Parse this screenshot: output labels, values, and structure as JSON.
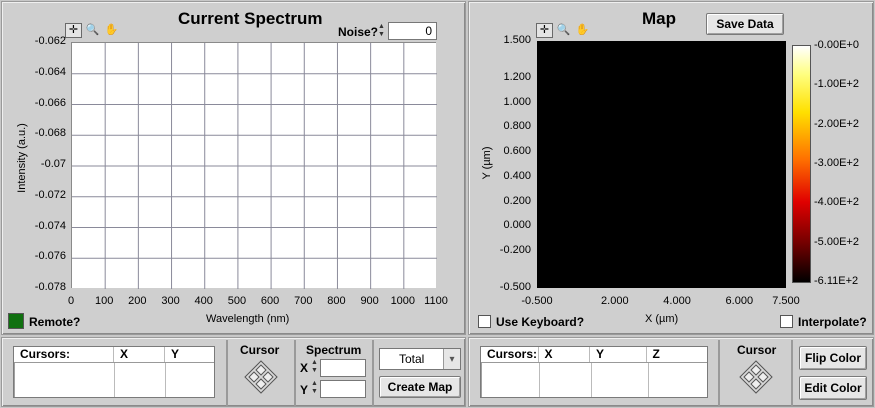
{
  "spectrum": {
    "title": "Current Spectrum",
    "noise_label": "Noise?",
    "noise_value": "0",
    "y_label": "Intensity (a.u.)",
    "x_label": "Wavelength (nm)",
    "y_ticks": [
      "-0.062",
      "-0.064",
      "-0.066",
      "-0.068",
      "-0.07",
      "-0.072",
      "-0.074",
      "-0.076",
      "-0.078"
    ],
    "x_ticks": [
      "0",
      "100",
      "200",
      "300",
      "400",
      "500",
      "600",
      "700",
      "800",
      "900",
      "1000",
      "1100"
    ],
    "remote_label": "Remote?"
  },
  "map": {
    "title": "Map",
    "save_button": "Save Data",
    "y_label": "Y (µm)",
    "x_label": "X (µm)",
    "y_ticks": [
      "1.500",
      "1.200",
      "1.000",
      "0.800",
      "0.600",
      "0.400",
      "0.200",
      "0.000",
      "-0.200",
      "-0.500"
    ],
    "x_ticks": [
      "-0.500",
      "2.000",
      "4.000",
      "6.000",
      "7.500"
    ],
    "colorbar_ticks": [
      "-0.00E+0",
      "-1.00E+2",
      "-2.00E+2",
      "-3.00E+2",
      "-4.00E+2",
      "-5.00E+2",
      "-6.11E+2"
    ],
    "use_keyboard_label": "Use Keyboard?",
    "interpolate_label": "Interpolate?"
  },
  "bottom_left": {
    "cursors_header": "Cursors:",
    "col_x": "X",
    "col_y": "Y",
    "cursor_label": "Cursor",
    "spectrum_label": "Spectrum",
    "x_label": "X",
    "y_label": "Y",
    "mode_value": "Total",
    "create_map_button": "Create Map"
  },
  "bottom_right": {
    "cursors_header": "Cursors:",
    "col_x": "X",
    "col_y": "Y",
    "col_z": "Z",
    "cursor_label": "Cursor",
    "flip_color_button": "Flip Color",
    "edit_color_button": "Edit Color"
  },
  "colors": {
    "led_green": "#107010",
    "map_fill": "#000000"
  }
}
